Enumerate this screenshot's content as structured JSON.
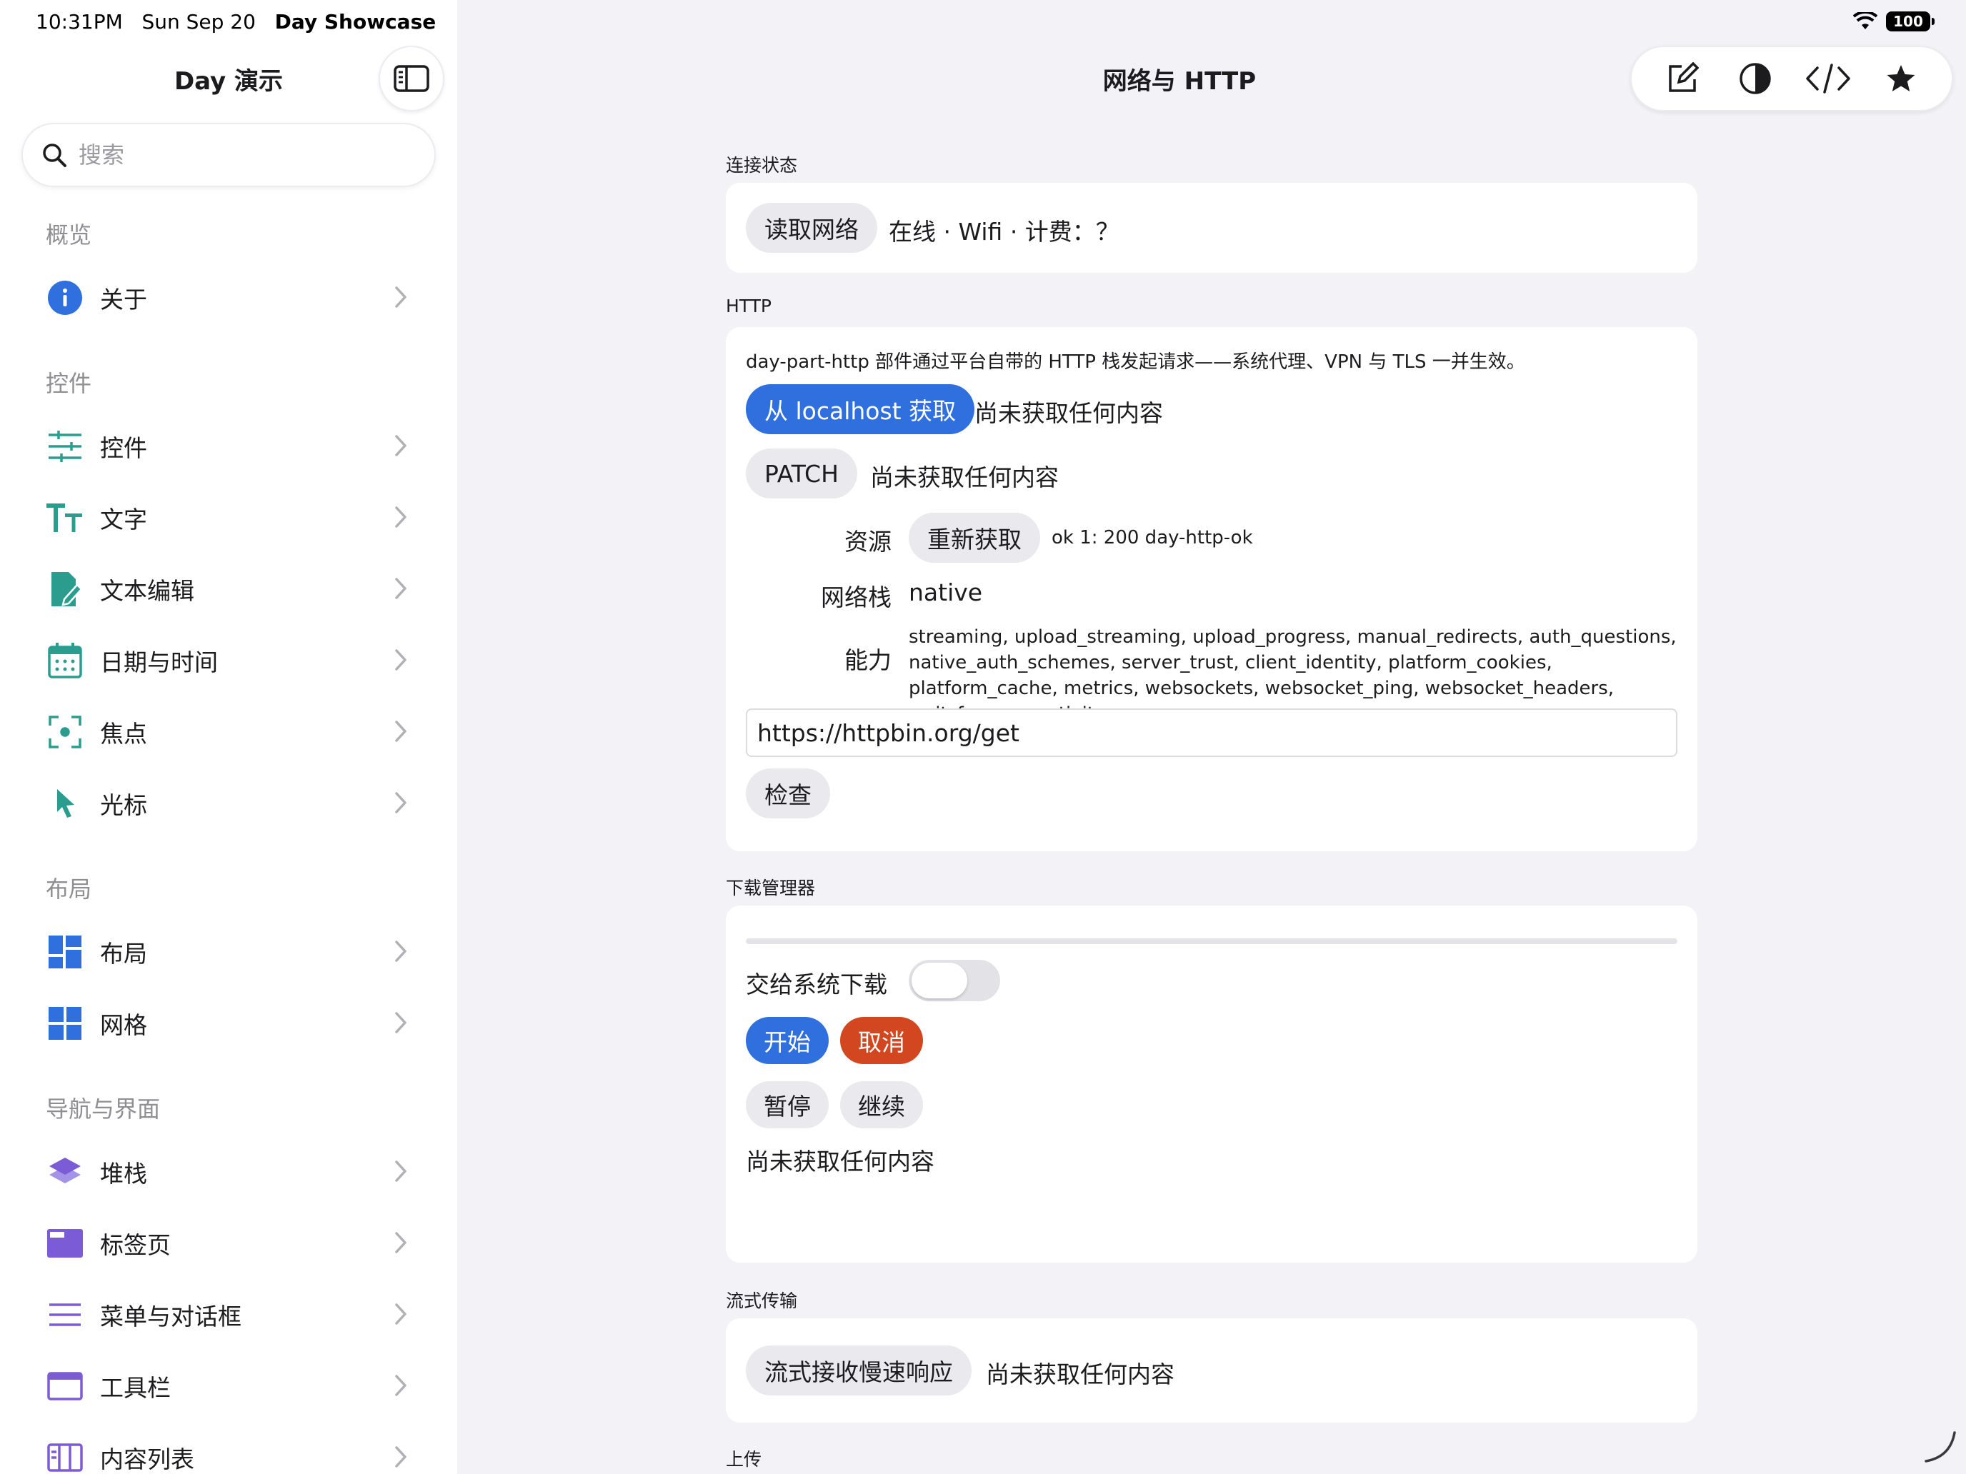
{
  "status_bar": {
    "time": "10:31PM",
    "date": "Sun Sep 20",
    "app_name": "Day Showcase",
    "battery": "100"
  },
  "sidebar": {
    "title": "Day 演示",
    "search_placeholder": "搜索",
    "sections": [
      {
        "header": "概览",
        "items": [
          {
            "label": "关于",
            "icon": "info-icon"
          }
        ]
      },
      {
        "header": "控件",
        "items": [
          {
            "label": "控件",
            "icon": "sliders-icon"
          },
          {
            "label": "文字",
            "icon": "text-size-icon"
          },
          {
            "label": "文本编辑",
            "icon": "document-edit-icon"
          },
          {
            "label": "日期与时间",
            "icon": "calendar-icon"
          },
          {
            "label": "焦点",
            "icon": "focus-icon"
          },
          {
            "label": "光标",
            "icon": "pointer-icon"
          }
        ]
      },
      {
        "header": "布局",
        "items": [
          {
            "label": "布局",
            "icon": "layout-icon"
          },
          {
            "label": "网格",
            "icon": "grid-icon"
          }
        ]
      },
      {
        "header": "导航与界面",
        "items": [
          {
            "label": "堆栈",
            "icon": "stack-icon"
          },
          {
            "label": "标签页",
            "icon": "tabs-icon"
          },
          {
            "label": "菜单与对话框",
            "icon": "menu-icon"
          },
          {
            "label": "工具栏",
            "icon": "toolbar-icon"
          },
          {
            "label": "内容列表",
            "icon": "content-list-icon"
          }
        ]
      }
    ]
  },
  "main": {
    "title": "网络与 HTTP",
    "toolbar": [
      "compose-icon",
      "contrast-icon",
      "code-icon",
      "star-icon"
    ],
    "connection": {
      "header": "连接状态",
      "button": "读取网络",
      "status": "在线 · Wifi · 计费：？"
    },
    "http": {
      "header": "HTTP",
      "description": "day-part-http 部件通过平台自带的 HTTP 栈发起请求——系统代理、VPN 与 TLS 一并生效。",
      "localhost_button": "从 localhost 获取",
      "localhost_result": "尚未获取任何内容",
      "patch_button": "PATCH",
      "patch_result": "尚未获取任何内容",
      "resource_label": "资源",
      "refetch_button": "重新获取",
      "resource_result": "ok 1: 200 day-http-ok",
      "stack_label": "网络栈",
      "stack_value": "native",
      "caps_label": "能力",
      "caps_value": "streaming, upload_streaming, upload_progress, manual_redirects, auth_questions, native_auth_schemes, server_trust, client_identity, platform_cookies, platform_cache, metrics, websockets, websocket_ping, websocket_headers, wait_for_connectivity",
      "url_value": "https://httpbin.org/get",
      "check_button": "检查"
    },
    "download": {
      "header": "下载管理器",
      "progress": 0,
      "toggle_label": "交给系统下载",
      "toggle_on": false,
      "start_button": "开始",
      "cancel_button": "取消",
      "pause_button": "暂停",
      "resume_button": "继续",
      "status": "尚未获取任何内容"
    },
    "streaming": {
      "header": "流式传输",
      "button": "流式接收慢速响应",
      "result": "尚未获取任何内容"
    },
    "upload": {
      "header": "上传"
    }
  },
  "colors": {
    "accent_blue": "#2f6fde",
    "destructive": "#d2471f",
    "sidebar_icon_teal": "#2a9d8f",
    "sidebar_icon_blue": "#2f6fde",
    "sidebar_icon_purple": "#7b5bd6"
  }
}
